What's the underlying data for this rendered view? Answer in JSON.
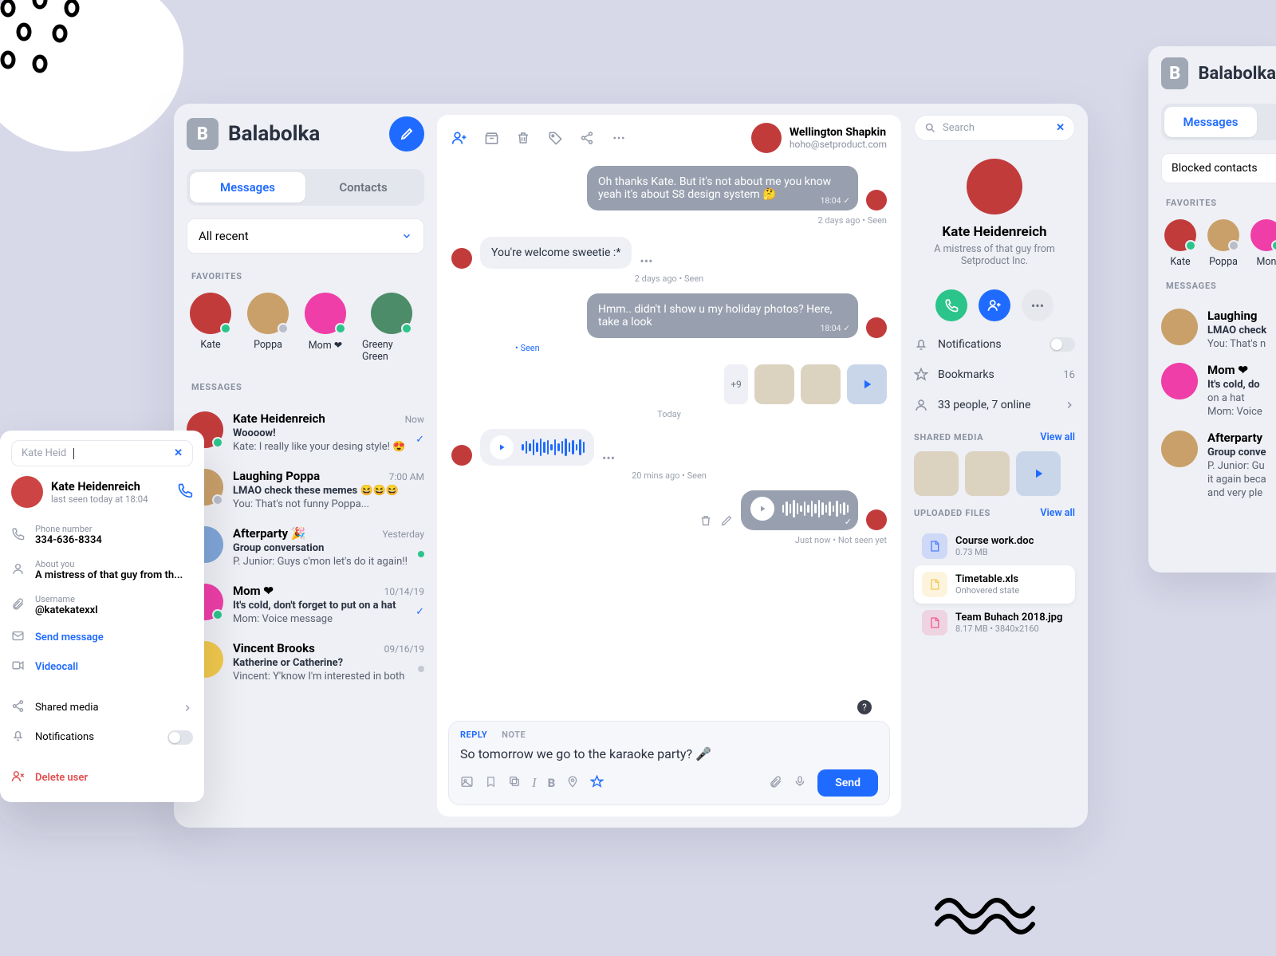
{
  "app": {
    "name": "Balabolka"
  },
  "tabs": {
    "messages": "Messages",
    "contacts": "Contacts"
  },
  "filter": {
    "label": "All recent"
  },
  "sections": {
    "favorites": "FAVORITES",
    "messages": "MESSAGES"
  },
  "favorites": [
    {
      "name": "Kate",
      "status": "on",
      "color": "c-red"
    },
    {
      "name": "Poppa",
      "status": "off",
      "color": "c-tan"
    },
    {
      "name": "Mom ❤",
      "status": "on",
      "color": "c-pink"
    },
    {
      "name": "Greeny Green",
      "status": "on",
      "color": "c-green"
    }
  ],
  "conversations": [
    {
      "name": "Kate Heidenreich",
      "time": "Now",
      "line1": "Woooow!",
      "line2": "Kate: I really like your desing style! 😍",
      "status": "tick",
      "dot": "on",
      "color": "c-red"
    },
    {
      "name": "Laughing Poppa",
      "time": "7:00 AM",
      "line1": "LMAO check these memes 😆😆😆",
      "line2": "You: That's not funny Poppa...",
      "status": "none",
      "dot": "off",
      "color": "c-tan"
    },
    {
      "name": "Afterparty 🎉",
      "time": "Yesterday",
      "line1": "Group conversation",
      "line2": "P. Junior: Guys c'mon let's do it again!!",
      "status": "bullet",
      "dot": "",
      "color": "c-blue"
    },
    {
      "name": "Mom ❤",
      "time": "10/14/19",
      "line1": "It's cold, don't forget to put on a hat",
      "line2": "Mom: Voice message",
      "status": "tick",
      "dot": "on",
      "color": "c-pink"
    },
    {
      "name": "Vincent Brooks",
      "time": "09/16/19",
      "line1": "Katherine or Catherine?",
      "line2": "Vincent: Y'know I'm interested in both",
      "status": "graybullet",
      "dot": "",
      "color": "c-yellow"
    }
  ],
  "chat": {
    "peer": {
      "name": "Wellington Shapkin",
      "email": "hoho@setproduct.com"
    },
    "m1": {
      "text": "Oh thanks Kate. But it's not about me you know yeah it's about S8 design system 🤔",
      "time": "18:04 ✓",
      "meta": "2 days ago • Seen"
    },
    "m2": {
      "text": "You're welcome sweetie :*",
      "meta": "2 days ago • Seen"
    },
    "m3": {
      "text": "Hmm.. didn't I show u my holiday photos? Here, take a look",
      "time": "18:04 ✓",
      "meta": "• Seen"
    },
    "thumbs_more": "+9",
    "today": "Today",
    "voice_in_meta": "20 mins ago • Seen",
    "voice_out_meta": "Just now • Not seen yet",
    "composer": {
      "tabs": {
        "reply": "REPLY",
        "note": "NOTE"
      },
      "text": "So tomorrow we go to the karaoke party? 🎤",
      "send": "Send"
    }
  },
  "right": {
    "search": {
      "placeholder": "Search"
    },
    "profile": {
      "name": "Kate Heidenreich",
      "bio": "A mistress of that guy from Setproduct Inc."
    },
    "settings": {
      "notifications": "Notifications",
      "bookmarks": "Bookmarks",
      "bookmarks_count": "16",
      "people": "33 people, 7 online"
    },
    "shared": {
      "label": "SHARED MEDIA",
      "viewall": "View all"
    },
    "uploaded": {
      "label": "UPLOADED FILES",
      "viewall": "View all"
    },
    "files": [
      {
        "name": "Course work.doc",
        "meta": "0.73 MB",
        "color": "#4f7fff"
      },
      {
        "name": "Timetable.xls",
        "meta": "Onhovered state",
        "color": "#f5c85a",
        "hover": true
      },
      {
        "name": "Team Buhach 2018.jpg",
        "meta": "8.17 MB • 3840x2160",
        "color": "#f25d8e"
      }
    ]
  },
  "popout": {
    "query": "Kate Heid",
    "name": "Kate Heidenreich",
    "seen": "last seen today at 18:04",
    "phone_label": "Phone number",
    "phone": "334-636-8334",
    "about_label": "About you",
    "about": "A mistress of that guy from th...",
    "user_label": "Username",
    "user": "@katekatexxl",
    "send": "Send message",
    "video": "Videocall",
    "shared": "Shared media",
    "notif": "Notifications",
    "delete": "Delete user"
  },
  "crop": {
    "blocked": "Blocked contacts",
    "favorites": "FAVORITES",
    "fav": [
      "Kate",
      "Poppa",
      "Mon"
    ],
    "messages_label": "MESSAGES",
    "items": [
      {
        "title": "Laughing ",
        "l1": "LMAO check",
        "l2": "You: That's n"
      },
      {
        "title": "Mom ❤",
        "l1": "It's cold, do",
        "l2": "on a hat",
        "l3": "Mom: Voice"
      },
      {
        "title": "Afterparty",
        "l1": "Group conve",
        "l2": "P. Junior: Gu",
        "l3": "it again beca",
        "l4": "and very ple"
      }
    ]
  }
}
